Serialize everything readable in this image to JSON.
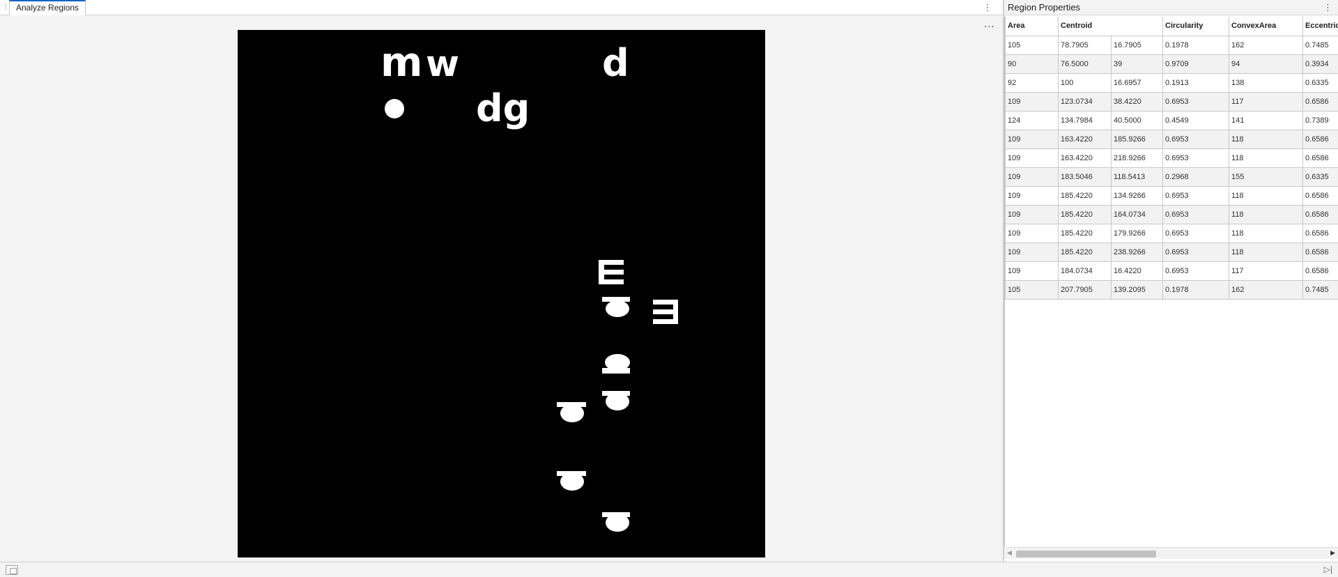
{
  "document": {
    "tab_label": "Analyze Regions",
    "grip_icon": "grip-icon",
    "menu_icon": "vertical-ellipsis-icon",
    "axes_toolbar_icon": "horizontal-ellipsis-icon"
  },
  "panel": {
    "title": "Region Properties",
    "menu_icon": "vertical-ellipsis-icon"
  },
  "table": {
    "headers": [
      "Area",
      "Centroid",
      "Circularity",
      "ConvexArea",
      "Eccentric"
    ],
    "rows": [
      [
        "105",
        "78.7905",
        "16.7905",
        "0.1978",
        "162",
        "0.7485"
      ],
      [
        "90",
        "76.5000",
        "39",
        "0.9709",
        "94",
        "0.3934"
      ],
      [
        "92",
        "100",
        "16.6957",
        "0.1913",
        "138",
        "0.6335"
      ],
      [
        "109",
        "123.0734",
        "38.4220",
        "0.6953",
        "117",
        "0.6586"
      ],
      [
        "124",
        "134.7984",
        "40.5000",
        "0.4549",
        "141",
        "0.7389"
      ],
      [
        "109",
        "163.4220",
        "185.9266",
        "0.6953",
        "118",
        "0.6586"
      ],
      [
        "109",
        "163.4220",
        "218.9266",
        "0.6953",
        "118",
        "0.6586"
      ],
      [
        "109",
        "183.5046",
        "118.5413",
        "0.2968",
        "155",
        "0.6335"
      ],
      [
        "109",
        "185.4220",
        "134.9266",
        "0.6953",
        "118",
        "0.6586"
      ],
      [
        "109",
        "185.4220",
        "164.0734",
        "0.6953",
        "118",
        "0.6586"
      ],
      [
        "109",
        "185.4220",
        "179.9266",
        "0.6953",
        "118",
        "0.6586"
      ],
      [
        "109",
        "185.4220",
        "238.9266",
        "0.6953",
        "118",
        "0.6586"
      ],
      [
        "109",
        "184.0734",
        "16.4220",
        "0.6953",
        "117",
        "0.6586"
      ],
      [
        "105",
        "207.7905",
        "139.2095",
        "0.1978",
        "162",
        "0.7485"
      ]
    ]
  },
  "image": {
    "glyphs": [
      "m",
      "w",
      "d",
      "dg"
    ],
    "background": "#000000",
    "foreground": "#ffffff"
  },
  "status": {
    "left_icon": "panel-toggle-icon",
    "right_icon": "collapse-right-icon"
  },
  "colors": {
    "accent": "#0e63c6"
  }
}
